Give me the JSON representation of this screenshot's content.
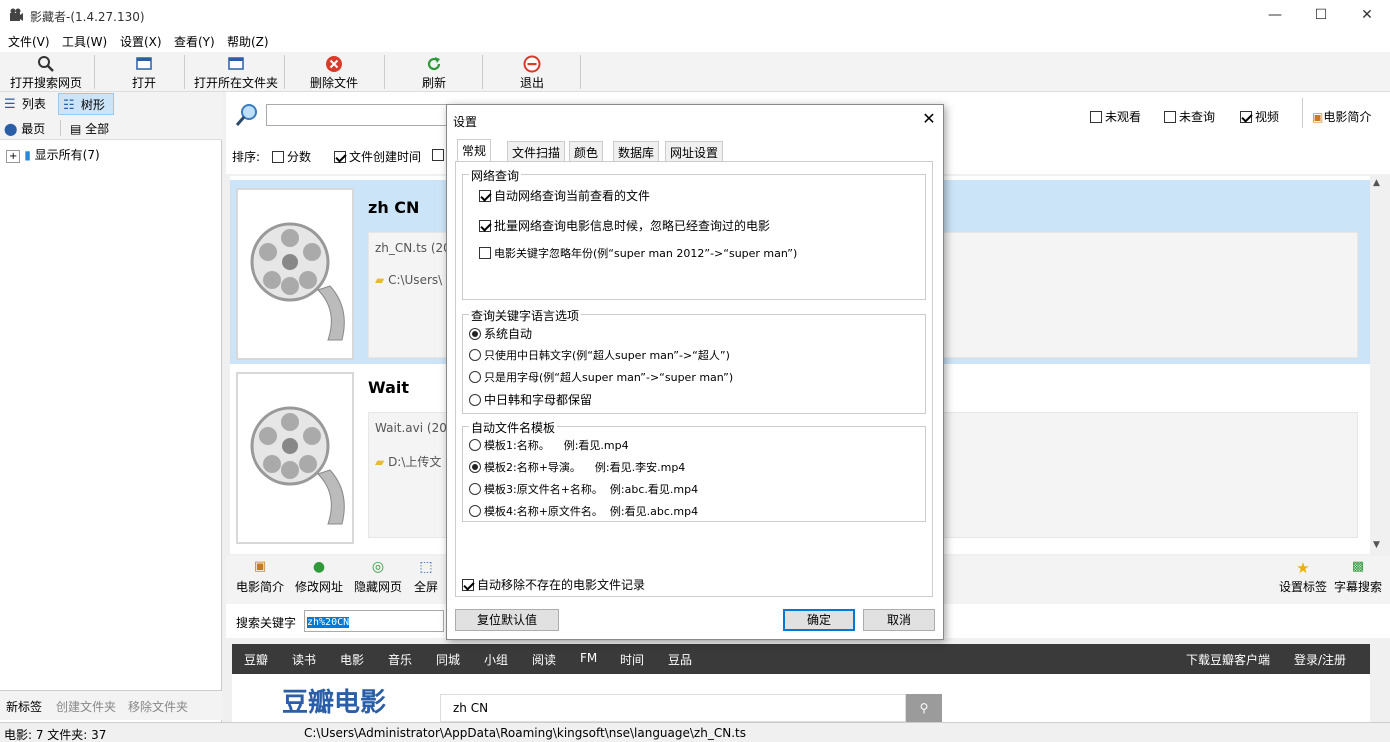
{
  "window": {
    "title": "影藏者-(1.4.27.130)",
    "minimize_glyph": "—",
    "maximize_glyph": "☐",
    "close_glyph": "✕"
  },
  "menu": [
    "文件(V)",
    "工具(W)",
    "设置(X)",
    "查看(Y)",
    "帮助(Z)"
  ],
  "toolbar": {
    "open_search_web": "打开搜索网页",
    "open": "打开",
    "open_folder": "打开所在文件夹",
    "delete_file": "删除文件",
    "refresh": "刷新",
    "exit": "退出"
  },
  "left": {
    "view_list": "列表",
    "view_tree": "树形",
    "top_page": "最页",
    "all": "全部",
    "tree_root": "显示所有(7)",
    "new_tag": "新标签",
    "create_folder": "创建文件夹",
    "remove_folder": "移除文件夹"
  },
  "filters": {
    "sort_label": "排序:",
    "score": "分数",
    "created_time": "文件创建时间",
    "unwatched": "未观看",
    "unqueried": "未查询",
    "video": "视频",
    "movie_intro": "电影简介"
  },
  "items": [
    {
      "name": "zh CN",
      "file": "zh_CN.ts (2021",
      "path": "C:\\Users\\"
    },
    {
      "name": "Wait",
      "file": "Wait.avi (2021",
      "path": "D:\\上传文"
    }
  ],
  "bottom_toolbar": {
    "intro": "电影简介",
    "modify_url": "修改网址",
    "hide_web": "隐藏网页",
    "fullscreen": "全屏",
    "set_tag": "设置标签",
    "subtitle_search": "字幕搜索"
  },
  "keyword": {
    "label": "搜索关键字",
    "value": "zh%20CN"
  },
  "web": {
    "nav": [
      "豆瓣",
      "读书",
      "电影",
      "音乐",
      "同城",
      "小组",
      "阅读",
      "FM",
      "时间",
      "豆品"
    ],
    "download_client": "下载豆瓣客户端",
    "login": "登录/注册",
    "logo": "豆瓣电影",
    "search_value": "zh CN"
  },
  "status": {
    "counts": "电影: 7 文件夹: 37",
    "path": "C:\\Users\\Administrator\\AppData\\Roaming\\kingsoft\\nse\\language\\zh_CN.ts"
  },
  "dialog": {
    "title": "设置",
    "tabs": [
      "常规",
      "文件扫描",
      "颜色",
      "数据库",
      "网址设置"
    ],
    "net_group": "网络查询",
    "net_opt1": "自动网络查询当前查看的文件",
    "net_opt2": "批量网络查询电影信息时候，忽略已经查询过的电影",
    "net_opt3": "电影关键字忽略年份(例“super man 2012”->“super man”)",
    "lang_group": "查询关键字语言选项",
    "lang_opt1": "系统自动",
    "lang_opt2": "只使用中日韩文字(例“超人super man”->“超人”)",
    "lang_opt3": "只是用字母(例“超人super man”->“super man”)",
    "lang_opt4": "中日韩和字母都保留",
    "tpl_group": "自动文件名模板",
    "tpl_opt1": "模板1:名称。    例:看见.mp4",
    "tpl_opt2": "模板2:名称+导演。    例:看见.李安.mp4",
    "tpl_opt3": "模板3:原文件名+名称。  例:abc.看见.mp4",
    "tpl_opt4": "模板4:名称+原文件名。  例:看见.abc.mp4",
    "auto_remove": "自动移除不存在的电影文件记录",
    "reset": "复位默认值",
    "ok": "确定",
    "cancel": "取消"
  }
}
